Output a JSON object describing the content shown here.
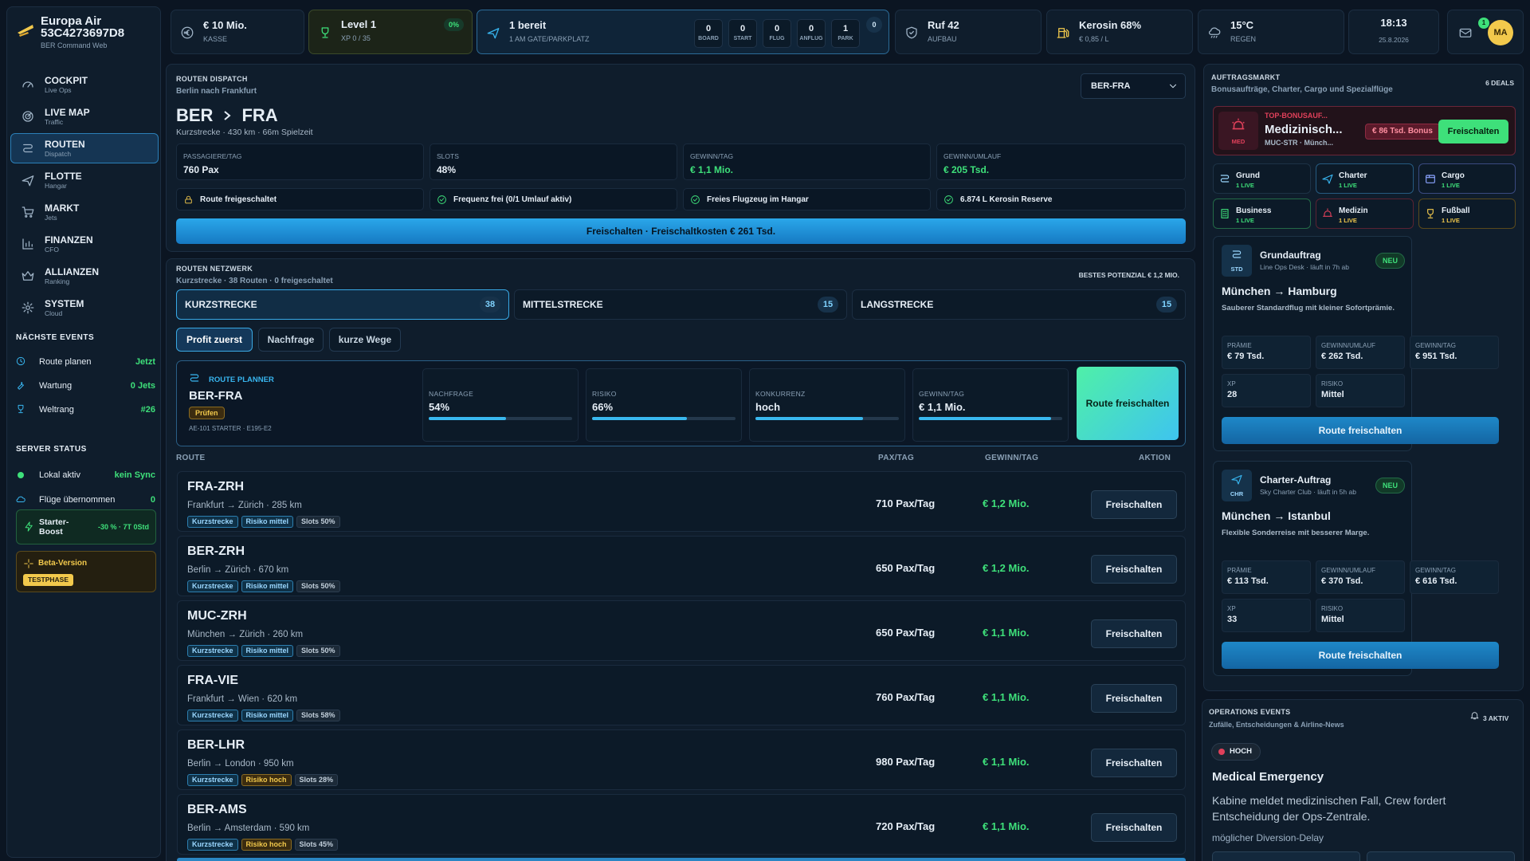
{
  "brand": {
    "name": "Europa Air",
    "code": "53C4273697D8",
    "sub": "BER Command Web"
  },
  "nav": [
    {
      "label": "COCKPIT",
      "sub": "Live Ops"
    },
    {
      "label": "LIVE MAP",
      "sub": "Traffic"
    },
    {
      "label": "ROUTEN",
      "sub": "Dispatch"
    },
    {
      "label": "FLOTTE",
      "sub": "Hangar"
    },
    {
      "label": "MARKT",
      "sub": "Jets"
    },
    {
      "label": "FINANZEN",
      "sub": "CFO"
    },
    {
      "label": "ALLIANZEN",
      "sub": "Ranking"
    },
    {
      "label": "SYSTEM",
      "sub": "Cloud"
    }
  ],
  "events": {
    "title": "NÄCHSTE EVENTS",
    "items": [
      {
        "label": "Route planen",
        "value": "Jetzt"
      },
      {
        "label": "Wartung",
        "value": "0 Jets"
      },
      {
        "label": "Weltrang",
        "value": "#26"
      }
    ]
  },
  "server": {
    "title": "SERVER STATUS",
    "items": [
      {
        "label": "Lokal aktiv",
        "value": "kein Sync"
      },
      {
        "label": "Flüge übernommen",
        "value": "0"
      }
    ],
    "boost_label": "Starter-Boost",
    "boost_value": "-30 % · 7T 0Std",
    "beta_label": "Beta-Version",
    "beta_badge": "TESTPHASE"
  },
  "topbar": {
    "cash": {
      "value": "€ 10 Mio.",
      "sub": "KASSE"
    },
    "level": {
      "value": "Level 1",
      "sub": "XP 0 / 35",
      "pct": "0%"
    },
    "fleet": {
      "value": "1 bereit",
      "sub": "1 AM GATE/PARKPLATZ",
      "extra": "0",
      "stages": [
        {
          "n": "0",
          "k": "BOARD"
        },
        {
          "n": "0",
          "k": "START"
        },
        {
          "n": "0",
          "k": "FLUG"
        },
        {
          "n": "0",
          "k": "ANFLUG"
        },
        {
          "n": "1",
          "k": "PARK"
        }
      ]
    },
    "rep": {
      "value": "Ruf 42",
      "sub": "AUFBAU"
    },
    "fuel": {
      "value": "Kerosin 68%",
      "sub": "€ 0,85 / L"
    },
    "weather": {
      "value": "15°C",
      "sub": "REGEN"
    },
    "clock": {
      "time": "18:13",
      "date": "25.8.2026"
    },
    "mail_count": "1",
    "avatar": "MA"
  },
  "dispatch": {
    "title": "ROUTEN DISPATCH",
    "subtitle": "Berlin nach Frankfurt",
    "select": "BER-FRA",
    "from": "BER",
    "to": "FRA",
    "info": "Kurzstrecke · 430 km · 66m Spielzeit",
    "stats": [
      {
        "k": "PASSAGIERE/TAG",
        "v": "760 Pax"
      },
      {
        "k": "SLOTS",
        "v": "48%"
      },
      {
        "k": "GEWINN/TAG",
        "v": "€ 1,1 Mio."
      },
      {
        "k": "GEWINN/UMLAUF",
        "v": "€ 205 Tsd."
      }
    ],
    "checks": [
      "Route freigeschaltet",
      "Frequenz frei (0/1 Umlauf aktiv)",
      "Freies Flugzeug im Hangar",
      "6.874 L Kerosin Reserve"
    ],
    "unlock_button": "Freischalten · Freischaltkosten € 261 Tsd."
  },
  "network": {
    "title": "ROUTEN NETZWERK",
    "subtitle": "Kurzstrecke · 38 Routen · 0 freigeschaltet",
    "best": "BESTES POTENZIAL € 1,2 MIO.",
    "tabs": [
      {
        "label": "KURZSTRECKE",
        "count": "38"
      },
      {
        "label": "MITTELSTRECKE",
        "count": "15"
      },
      {
        "label": "LANGSTRECKE",
        "count": "15"
      }
    ],
    "filters": [
      "Profit zuerst",
      "Nachfrage",
      "kurze Wege"
    ],
    "planner": {
      "label": "ROUTE PLANNER",
      "route": "BER-FRA",
      "badge": "Prüfen",
      "aircraft": "AE-101 STARTER · E195-E2",
      "metrics": [
        {
          "k": "NACHFRAGE",
          "v": "54%",
          "fill": 0.54
        },
        {
          "k": "RISIKO",
          "v": "66%",
          "fill": 0.66
        },
        {
          "k": "KONKURRENZ",
          "v": "hoch",
          "fill": 0.75
        },
        {
          "k": "GEWINN/TAG",
          "v": "€ 1,1 Mio.",
          "fill": 0.92
        }
      ],
      "cta": "Route freischalten"
    },
    "columns": [
      "ROUTE",
      "PAX/TAG",
      "GEWINN/TAG",
      "AKTION"
    ],
    "rows": [
      {
        "code": "FRA-ZRH",
        "desc": "Frankfurt → Zürich · 285 km",
        "t1": "Kurzstrecke",
        "t2": "Risiko mittel",
        "t3": "Slots 50%",
        "pax": "710 Pax/Tag",
        "gain": "€ 1,2 Mio.",
        "action": "Freischalten"
      },
      {
        "code": "BER-ZRH",
        "desc": "Berlin → Zürich · 670 km",
        "t1": "Kurzstrecke",
        "t2": "Risiko mittel",
        "t3": "Slots 50%",
        "pax": "650 Pax/Tag",
        "gain": "€ 1,2 Mio.",
        "action": "Freischalten"
      },
      {
        "code": "MUC-ZRH",
        "desc": "München → Zürich · 260 km",
        "t1": "Kurzstrecke",
        "t2": "Risiko mittel",
        "t3": "Slots 50%",
        "pax": "650 Pax/Tag",
        "gain": "€ 1,1 Mio.",
        "action": "Freischalten"
      },
      {
        "code": "FRA-VIE",
        "desc": "Frankfurt → Wien · 620 km",
        "t1": "Kurzstrecke",
        "t2": "Risiko mittel",
        "t3": "Slots 58%",
        "pax": "760 Pax/Tag",
        "gain": "€ 1,1 Mio.",
        "action": "Freischalten"
      },
      {
        "code": "BER-LHR",
        "desc": "Berlin → London · 950 km",
        "t1": "Kurzstrecke",
        "t2": "Risiko hoch",
        "t3": "Slots 28%",
        "pax": "980 Pax/Tag",
        "gain": "€ 1,1 Mio.",
        "action": "Freischalten"
      },
      {
        "code": "BER-AMS",
        "desc": "Berlin → Amsterdam · 590 km",
        "t1": "Kurzstrecke",
        "t2": "Risiko hoch",
        "t3": "Slots 45%",
        "pax": "720 Pax/Tag",
        "gain": "€ 1,1 Mio.",
        "action": "Freischalten"
      }
    ]
  },
  "market": {
    "title": "AUFTRAGSMARKT",
    "subtitle": "Bonusaufträge, Charter, Cargo und Spezialflüge",
    "deals": "6 DEALS",
    "top": {
      "tag": "TOP-BONUSAUF...",
      "title": "Medizinisch...",
      "route": "MUC-STR · Münch...",
      "bonus": "€ 86 Tsd. Bonus",
      "button": "Freischalten",
      "icon_label": "MED"
    },
    "categories": [
      {
        "label": "Grund",
        "live": "1 LIVE"
      },
      {
        "label": "Charter",
        "live": "1 LIVE"
      },
      {
        "label": "Cargo",
        "live": "1 LIVE"
      },
      {
        "label": "Business",
        "live": "1 LIVE"
      },
      {
        "label": "Medizin",
        "live": "1 LIVE"
      },
      {
        "label": "Fußball",
        "live": "1 LIVE"
      }
    ],
    "offers": [
      {
        "icon_label": "STD",
        "title": "Grundauftrag",
        "sub": "Line Ops Desk · läuft in 7h ab",
        "badge": "NEU",
        "route": "München → Hamburg",
        "desc": "Sauberer Standardflug mit kleiner Sofortprämie.",
        "stats": [
          {
            "k": "PRÄMIE",
            "v": "€ 79 Tsd."
          },
          {
            "k": "GEWINN/UMLAUF",
            "v": "€ 262 Tsd."
          },
          {
            "k": "GEWINN/TAG",
            "v": "€ 951 Tsd."
          },
          {
            "k": "XP",
            "v": "28"
          },
          {
            "k": "RISIKO",
            "v": "Mittel"
          }
        ],
        "button": "Route freischalten"
      },
      {
        "icon_label": "CHR",
        "title": "Charter-Auftrag",
        "sub": "Sky Charter Club · läuft in 5h ab",
        "badge": "NEU",
        "route": "München → Istanbul",
        "desc": "Flexible Sonderreise mit besserer Marge.",
        "stats": [
          {
            "k": "PRÄMIE",
            "v": "€ 113 Tsd."
          },
          {
            "k": "GEWINN/UMLAUF",
            "v": "€ 370 Tsd."
          },
          {
            "k": "GEWINN/TAG",
            "v": "€ 616 Tsd."
          },
          {
            "k": "XP",
            "v": "33"
          },
          {
            "k": "RISIKO",
            "v": "Mittel"
          }
        ],
        "button": "Route freischalten"
      }
    ]
  },
  "ops": {
    "title": "OPERATIONS EVENTS",
    "subtitle": "Zufälle, Entscheidungen & Airline-News",
    "active": "3 AKTIV",
    "level": "HOCH",
    "event_title": "Medical Emergency",
    "event_text": "Kabine meldet medizinischen Fall, Crew fordert Entscheidung der Ops-Zentrale.",
    "event_note": "möglicher Diversion-Delay"
  },
  "colors": {
    "accent": "#38b6f0",
    "positive": "#3ee07a",
    "warning": "#f2c94c",
    "danger": "#e0405a"
  }
}
